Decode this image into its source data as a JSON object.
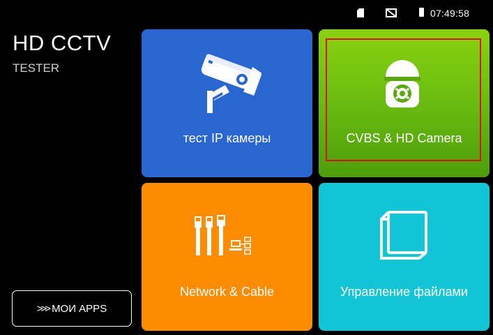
{
  "status_bar": {
    "time": "07:49:58",
    "icons": [
      "sd-card-icon",
      "cast-off-icon",
      "battery-icon"
    ]
  },
  "brand": {
    "title": "HD CCTV",
    "subtitle": "TESTER"
  },
  "apps_button": {
    "chevrons": ">>>",
    "label": "МОИ APPS"
  },
  "tiles": [
    {
      "label": "тест IP камеры",
      "icon": "ip-camera-icon",
      "color": "#2a66d1"
    },
    {
      "label": "CVBS & HD Camera",
      "icon": "dome-camera-icon",
      "color": "#6fc010",
      "selected": true
    },
    {
      "label": "Network & Cable",
      "icon": "network-cable-icon",
      "color": "#fd8c00"
    },
    {
      "label": "Управление файлами",
      "icon": "book-icon",
      "color": "#11c4d6"
    }
  ],
  "colors": {
    "background": "#000000",
    "highlight": "#e01010"
  }
}
